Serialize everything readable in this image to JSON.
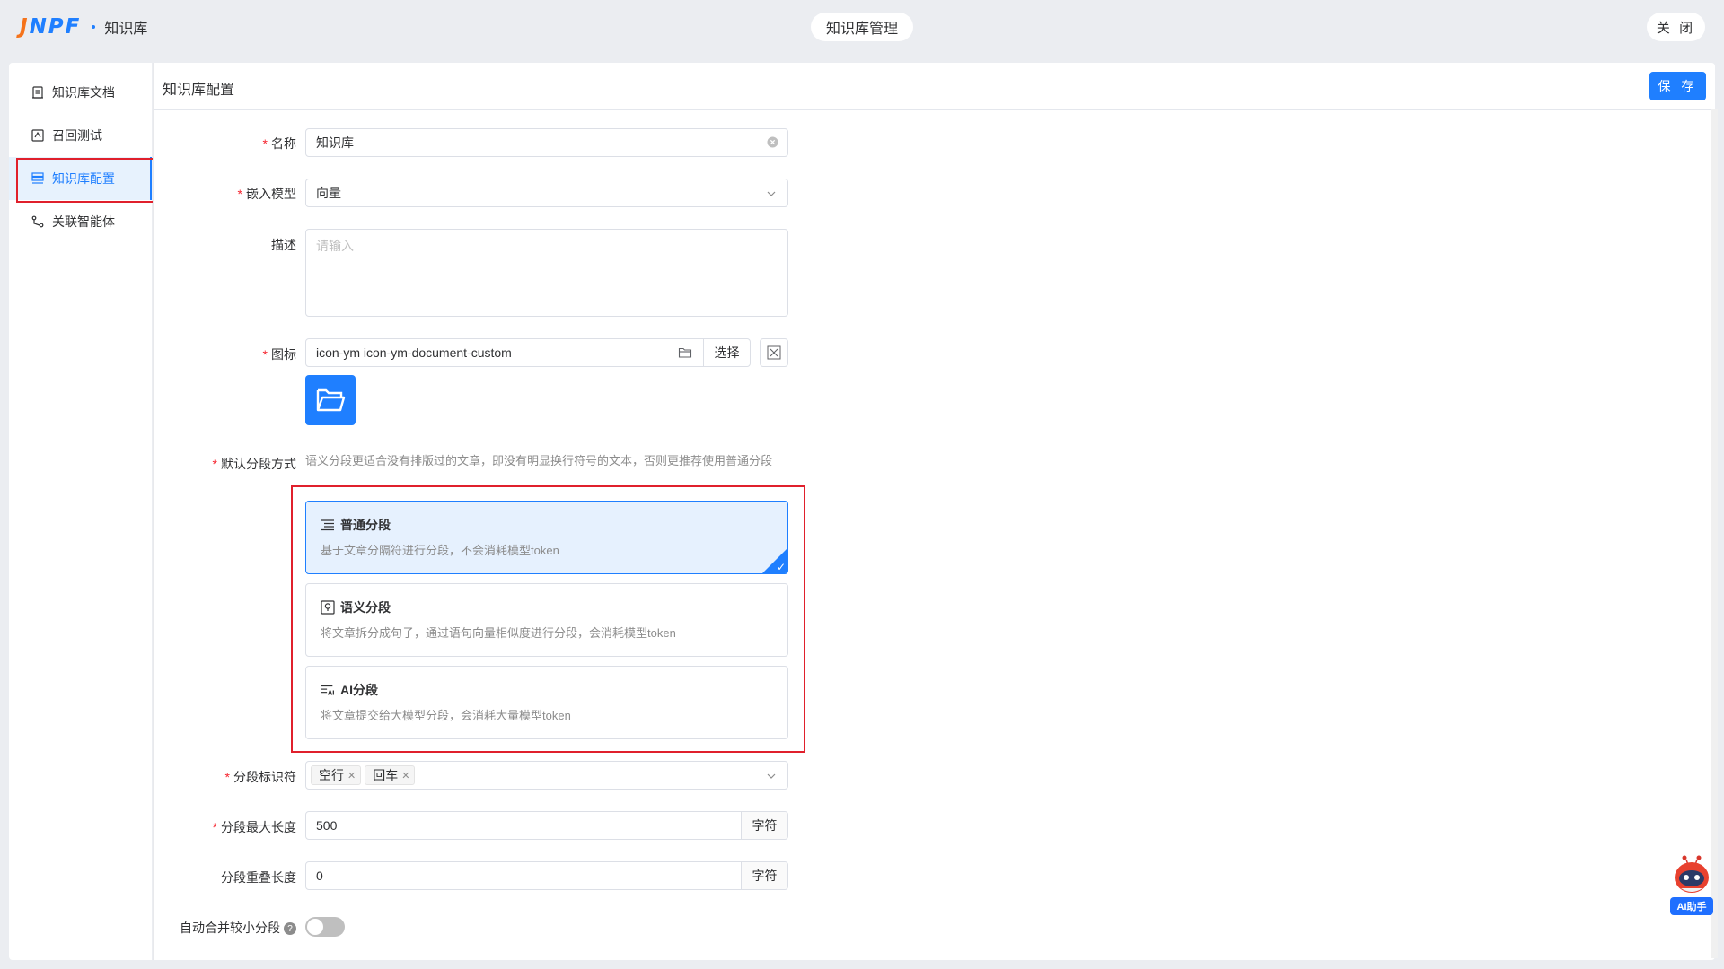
{
  "topbar": {
    "logo_j": "J",
    "logo_npf": "NPF",
    "app_name": "知识库",
    "center_title": "知识库管理",
    "close_label": "关 闭"
  },
  "sidebar": {
    "items": [
      {
        "label": "知识库文档",
        "icon": "document-icon"
      },
      {
        "label": "召回测试",
        "icon": "recall-test-icon"
      },
      {
        "label": "知识库配置",
        "icon": "config-icon",
        "active": true
      },
      {
        "label": "关联智能体",
        "icon": "agent-link-icon"
      }
    ]
  },
  "main": {
    "title": "知识库配置",
    "save_label": "保 存"
  },
  "form": {
    "name": {
      "label": "名称",
      "value": "知识库"
    },
    "embed_model": {
      "label": "嵌入模型",
      "value": "向量"
    },
    "description": {
      "label": "描述",
      "placeholder": "请输入"
    },
    "icon": {
      "label": "图标",
      "value": "icon-ym icon-ym-document-custom",
      "select_label": "选择"
    },
    "segment_mode": {
      "label": "默认分段方式",
      "description": "语义分段更适合没有排版过的文章，即没有明显换行符号的文本，否则更推荐使用普通分段",
      "options": [
        {
          "title": "普通分段",
          "desc": "基于文章分隔符进行分段，不会消耗模型token",
          "selected": true,
          "icon": "list-icon"
        },
        {
          "title": "语义分段",
          "desc": "将文章拆分成句子，通过语句向量相似度进行分段，会消耗模型token",
          "selected": false,
          "icon": "semantic-icon"
        },
        {
          "title": "AI分段",
          "desc": "将文章提交给大模型分段，会消耗大量模型token",
          "selected": false,
          "icon": "ai-text-icon"
        }
      ]
    },
    "separator": {
      "label": "分段标识符",
      "tags": [
        "空行",
        "回车"
      ]
    },
    "max_length": {
      "label": "分段最大长度",
      "value": "500",
      "unit": "字符"
    },
    "overlap_length": {
      "label": "分段重叠长度",
      "value": "0",
      "unit": "字符"
    },
    "auto_merge": {
      "label": "自动合并较小分段",
      "help": "?",
      "enabled": false
    }
  },
  "ai_helper": {
    "label": "AI助手"
  },
  "colors": {
    "accent": "#1f7fff",
    "brand_orange": "#f5731b",
    "required": "#f5222d",
    "highlight": "#e0202c"
  }
}
